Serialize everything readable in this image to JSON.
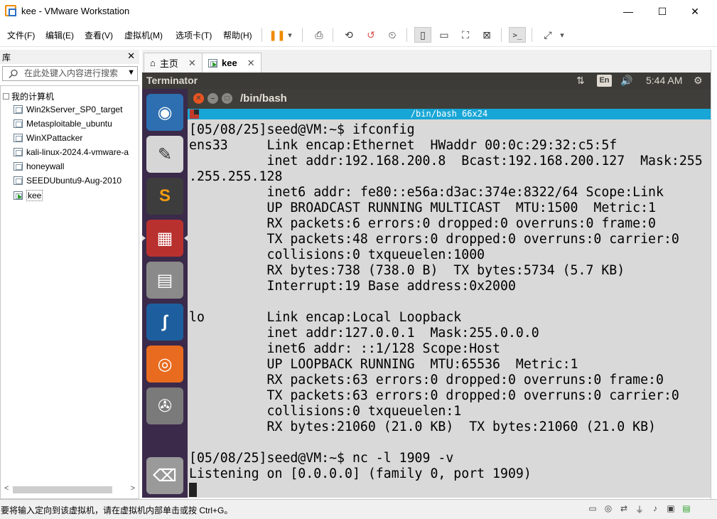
{
  "window": {
    "title": "kee - VMware Workstation",
    "minimize": "—",
    "maximize": "☐",
    "close": "✕"
  },
  "menu": {
    "items": [
      "文件(F)",
      "编辑(E)",
      "查看(V)",
      "虚拟机(M)",
      "选项卡(T)",
      "帮助(H)"
    ]
  },
  "toolbar": {
    "pause": "❚❚",
    "dropdown": "▾",
    "send_keys": "⎙",
    "snapshot": "⟲",
    "revert": "↺",
    "manage_snapshots": "⏲",
    "sidebar_toggle": "▯",
    "thumbnail_bar": "▭",
    "fullscreen": "⛶",
    "unity": "⊠",
    "console": ">_",
    "stretch": "⤢"
  },
  "library": {
    "title": "库",
    "close": "✕",
    "search_placeholder": "在此处键入内容进行搜索",
    "root": "我的计算机",
    "items": [
      "Win2kServer_SP0_target",
      "Metasploitable_ubuntu",
      "WinXPattacker",
      "kali-linux-2024.4-vmware-a",
      "honeywall",
      "SEEDUbuntu9-Aug-2010",
      "kee"
    ],
    "selected_index": 6
  },
  "tabs": {
    "items": [
      {
        "label": "主页",
        "close": "✕"
      },
      {
        "label": "kee",
        "close": "✕"
      }
    ],
    "active": 1
  },
  "guest": {
    "topbar": {
      "app": "Terminator",
      "lang": "En",
      "network": "⇅",
      "volume": "🔊",
      "time": "5:44 AM",
      "gear": "⚙"
    },
    "launcher": [
      {
        "name": "ubuntu-dash-icon",
        "glyph": "◉",
        "bg": "#2d6fb0"
      },
      {
        "name": "text-editor-icon",
        "glyph": "✎",
        "bg": "#d6d6d6"
      },
      {
        "name": "sublime-text-icon",
        "glyph": "S",
        "bg": "#3d3d3d"
      },
      {
        "name": "terminator-icon",
        "glyph": "▦",
        "bg": "#b8312f"
      },
      {
        "name": "file-manager-icon",
        "glyph": "▤",
        "bg": "#8a8a8a"
      },
      {
        "name": "wireshark-icon",
        "glyph": "∫",
        "bg": "#1d5f9e"
      },
      {
        "name": "firefox-icon",
        "glyph": "◎",
        "bg": "#e86b1f"
      },
      {
        "name": "system-settings-icon",
        "glyph": "✇",
        "bg": "#7a7a7a"
      },
      {
        "name": "trash-icon",
        "glyph": "⌫",
        "bg": "#9a9a9a"
      }
    ],
    "terminal": {
      "title": "/bin/bash",
      "bar": "/bin/bash 66x24",
      "lines": [
        "[05/08/25]seed@VM:~$ ifconfig",
        "ens33     Link encap:Ethernet  HWaddr 00:0c:29:32:c5:5f",
        "          inet addr:192.168.200.8  Bcast:192.168.200.127  Mask:255",
        ".255.255.128",
        "          inet6 addr: fe80::e56a:d3ac:374e:8322/64 Scope:Link",
        "          UP BROADCAST RUNNING MULTICAST  MTU:1500  Metric:1",
        "          RX packets:6 errors:0 dropped:0 overruns:0 frame:0",
        "          TX packets:48 errors:0 dropped:0 overruns:0 carrier:0",
        "          collisions:0 txqueuelen:1000",
        "          RX bytes:738 (738.0 B)  TX bytes:5734 (5.7 KB)",
        "          Interrupt:19 Base address:0x2000",
        "",
        "lo        Link encap:Local Loopback",
        "          inet addr:127.0.0.1  Mask:255.0.0.0",
        "          inet6 addr: ::1/128 Scope:Host",
        "          UP LOOPBACK RUNNING  MTU:65536  Metric:1",
        "          RX packets:63 errors:0 dropped:0 overruns:0 frame:0",
        "          TX packets:63 errors:0 dropped:0 overruns:0 carrier:0",
        "          collisions:0 txqueuelen:1",
        "          RX bytes:21060 (21.0 KB)  TX bytes:21060 (21.0 KB)",
        "",
        "[05/08/25]seed@VM:~$ nc -l 1909 -v",
        "Listening on [0.0.0.0] (family 0, port 1909)"
      ]
    }
  },
  "status": {
    "text": "要将输入定向到该虚拟机，请在虚拟机内部单击或按 Ctrl+G。"
  },
  "colors": {
    "launcher_bg": "#3b2a4a",
    "terminal_bar": "#17a6d6",
    "ubuntu_topbar": "#3c3b37",
    "pause_accent": "#f08a00"
  }
}
